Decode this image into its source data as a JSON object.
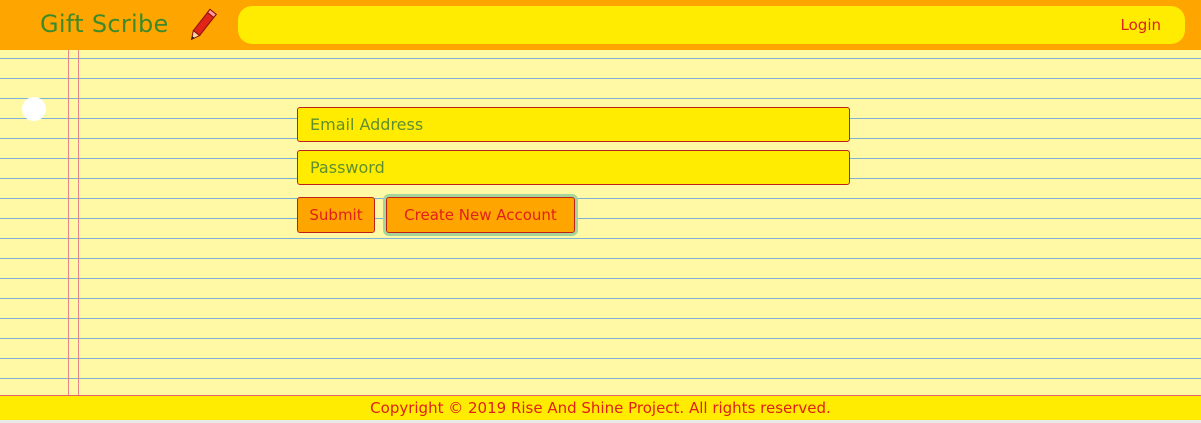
{
  "header": {
    "brand": "Gift Scribe",
    "brand_icon": "pencil-icon",
    "login_label": "Login"
  },
  "form": {
    "email_placeholder": "Email Address",
    "email_value": "",
    "password_placeholder": "Password",
    "password_value": "",
    "submit_label": "Submit",
    "create_label": "Create New Account"
  },
  "footer": {
    "copyright": "Copyright © 2019 Rise And Shine Project. All rights reserved."
  },
  "colors": {
    "header_bg": "#ffa500",
    "nav_bg": "#ffec00",
    "paper_bg": "#fff9a5",
    "brand_text": "#3d8a2a",
    "accent_text": "#e0201a"
  }
}
